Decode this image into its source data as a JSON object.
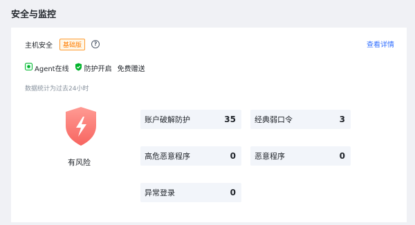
{
  "section": {
    "title": "安全与监控"
  },
  "host": {
    "label": "主机安全",
    "badge": "基础版",
    "help": "?",
    "details_link": "查看详情"
  },
  "status": {
    "agent": "Agent在线",
    "protect": "防护开启",
    "free": "免费赠送"
  },
  "note": "数据统计为过去24小时",
  "risk": {
    "label": "有风险",
    "color": "#f76560"
  },
  "metrics": {
    "account_crack": {
      "label": "账户破解防护",
      "value": "35"
    },
    "weak_password": {
      "label": "经典弱口令",
      "value": "3"
    },
    "high_risk_program": {
      "label": "高危恶意程序",
      "value": "0"
    },
    "malware": {
      "label": "恶意程序",
      "value": "0"
    },
    "abnormal_login": {
      "label": "异常登录",
      "value": "0"
    }
  }
}
